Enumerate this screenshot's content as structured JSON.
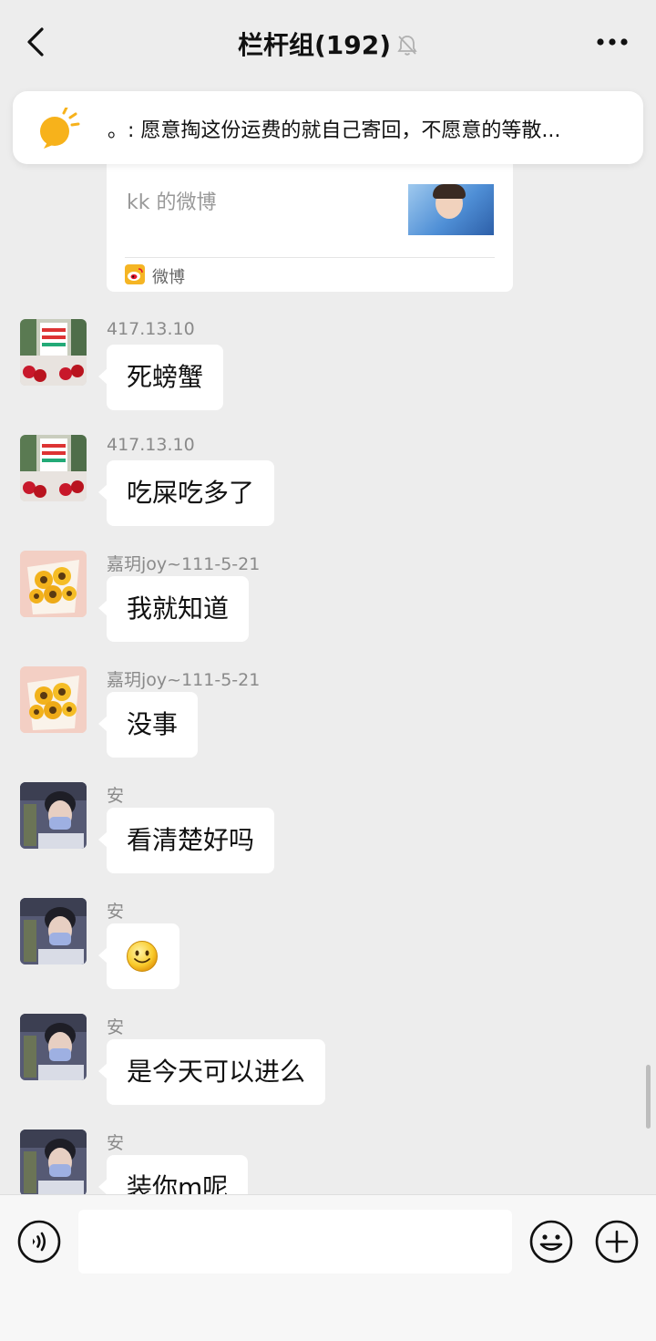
{
  "header": {
    "title": "栏杆组(192)",
    "back_icon": "chevron-left-icon",
    "muted_icon": "bell-off-icon",
    "more_icon": "more-horizontal-icon"
  },
  "pinned": {
    "icon": "lightbulb-icon",
    "text": "。: 愿意掏这份运费的就自己寄回，不愿意的等散..."
  },
  "share_card": {
    "title": "kk 的微博",
    "source_label": "微博",
    "source_icon": "weibo-icon"
  },
  "messages": [
    {
      "sender": "417.13.10",
      "text": "死螃蟹",
      "avatar": "banner-avatar"
    },
    {
      "sender": "417.13.10",
      "text": "吃屎吃多了",
      "avatar": "banner-avatar"
    },
    {
      "sender": "嘉玥joy~111-5-21",
      "text": "我就知道",
      "avatar": "sunflower-avatar"
    },
    {
      "sender": "嘉玥joy~111-5-21",
      "text": "没事",
      "avatar": "sunflower-avatar"
    },
    {
      "sender": "安",
      "text": "看清楚好吗",
      "avatar": "person-avatar"
    },
    {
      "sender": "安",
      "text": "",
      "avatar": "person-avatar",
      "emoji": "smile-emoji-icon"
    },
    {
      "sender": "安",
      "text": "是今天可以进么",
      "avatar": "person-avatar"
    },
    {
      "sender": "安",
      "text": "装你m呢",
      "avatar": "person-avatar"
    }
  ],
  "input": {
    "placeholder": "",
    "voice_icon": "voice-icon",
    "emoji_icon": "emoji-icon",
    "plus_icon": "plus-icon"
  },
  "colors": {
    "background": "#ededed",
    "bubble": "#ffffff",
    "sender_text": "#8a8a8a"
  }
}
